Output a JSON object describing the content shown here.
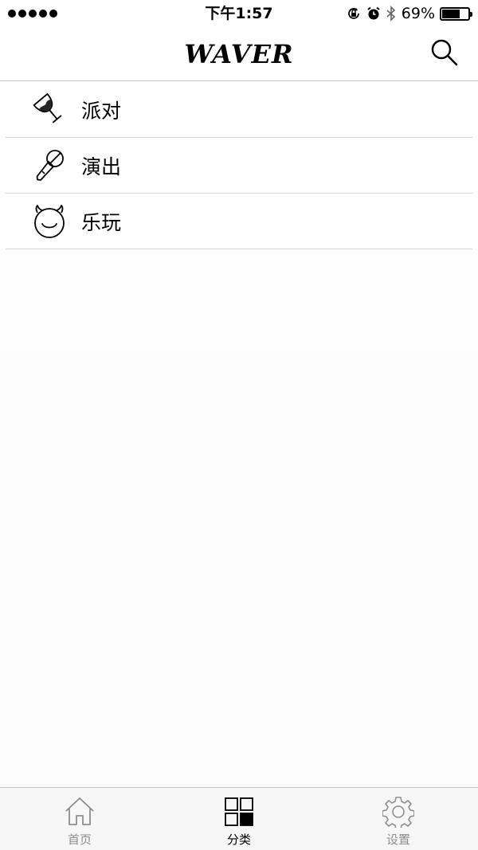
{
  "status_bar": {
    "time": "下午1:57",
    "battery": "69%",
    "battery_level": 0.69,
    "signal_bars": 5
  },
  "nav": {
    "title": "WAVER",
    "search_icon": "search-icon"
  },
  "categories": [
    {
      "label": "派对",
      "icon": "wine-glass-icon"
    },
    {
      "label": "演出",
      "icon": "microphone-icon"
    },
    {
      "label": "乐玩",
      "icon": "devil-face-icon"
    }
  ],
  "tabs": [
    {
      "label": "首页",
      "icon": "home-icon",
      "active": false
    },
    {
      "label": "分类",
      "icon": "category-grid-icon",
      "active": true
    },
    {
      "label": "设置",
      "icon": "gear-icon",
      "active": false
    }
  ],
  "colors": {
    "text": "#000000",
    "tab_inactive": "#8e8e8e",
    "divider": "#d4d4d4",
    "tab_bar_bg": "#f7f7f7"
  }
}
